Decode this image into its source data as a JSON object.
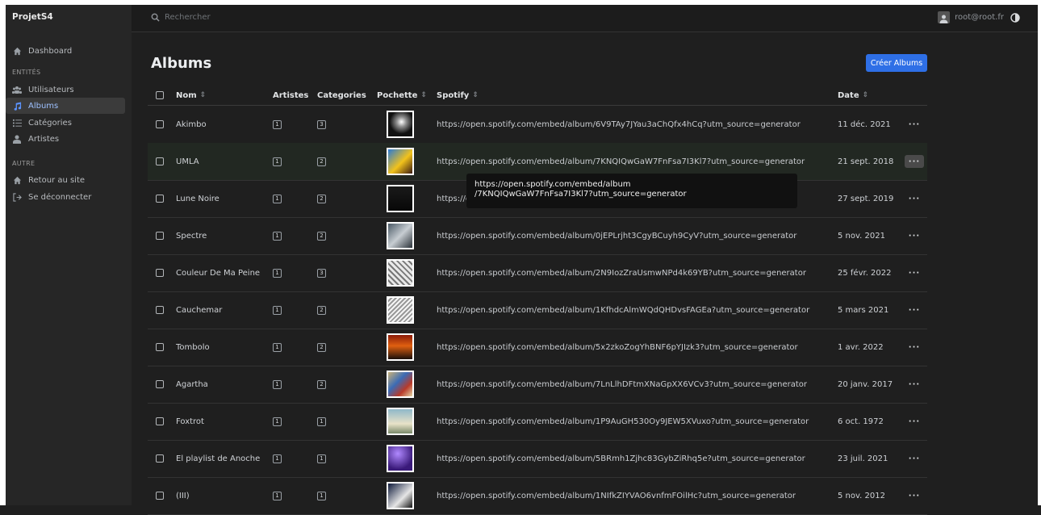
{
  "app": {
    "name": "ProjetS4"
  },
  "sidebar": {
    "items": [
      {
        "label": "Dashboard",
        "icon": "home-icon"
      },
      {
        "label": "Utilisateurs",
        "icon": "users-icon"
      },
      {
        "label": "Albums",
        "icon": "music-icon"
      },
      {
        "label": "Catégories",
        "icon": "list-icon"
      },
      {
        "label": "Artistes",
        "icon": "user-icon"
      },
      {
        "label": "Retour au site",
        "icon": "home-icon"
      },
      {
        "label": "Se déconnecter",
        "icon": "sign-out-icon"
      }
    ],
    "sections": {
      "entities": "ENTITÉS",
      "other": "AUTRE"
    },
    "active": "Albums"
  },
  "header": {
    "search_placeholder": "Rechercher",
    "user": "root@root.fr"
  },
  "page": {
    "title": "Albums",
    "create_label": "Créer Albums"
  },
  "table": {
    "columns": {
      "name": "Nom",
      "artists": "Artistes",
      "categories": "Categories",
      "cover": "Pochette",
      "spotify": "Spotify",
      "date": "Date",
      "sort_glyph": "⇕"
    },
    "rows": [
      {
        "name": "Akimbo",
        "artists": "1",
        "categories": "3",
        "spotify": "https://open.spotify.com/embed/album/6V9TAy7JYau3aChQfx4hCq?utm_source=generator",
        "date": "11 déc. 2021"
      },
      {
        "name": "UMLA",
        "artists": "1",
        "categories": "2",
        "spotify": "https://open.spotify.com/embed/album/7KNQIQwGaW7FnFsa7I3Kl7?utm_source=generator",
        "date": "21 sept. 2018"
      },
      {
        "name": "Lune Noire",
        "artists": "1",
        "categories": "2",
        "spotify": "https://open.spotify.com/embed/album/...?utm_source=generator",
        "date": "27 sept. 2019"
      },
      {
        "name": "Spectre",
        "artists": "1",
        "categories": "2",
        "spotify": "https://open.spotify.com/embed/album/0jEPLrjht3CgyBCuyh9CyV?utm_source=generator",
        "date": "5 nov. 2021"
      },
      {
        "name": "Couleur De Ma Peine",
        "artists": "1",
        "categories": "3",
        "spotify": "https://open.spotify.com/embed/album/2N9IozZraUsmwNPd4k69YB?utm_source=generator",
        "date": "25 févr. 2022"
      },
      {
        "name": "Cauchemar",
        "artists": "1",
        "categories": "2",
        "spotify": "https://open.spotify.com/embed/album/1KfhdcAlmWQdQHDvsFAGEa?utm_source=generator",
        "date": "5 mars 2021"
      },
      {
        "name": "Tombolo",
        "artists": "1",
        "categories": "2",
        "spotify": "https://open.spotify.com/embed/album/5x2zkoZogYhBNF6pYJIzk3?utm_source=generator",
        "date": "1 avr. 2022"
      },
      {
        "name": "Agartha",
        "artists": "1",
        "categories": "2",
        "spotify": "https://open.spotify.com/embed/album/7LnLlhDFtmXNaGpXX6VCv3?utm_source=generator",
        "date": "20 janv. 2017"
      },
      {
        "name": "Foxtrot",
        "artists": "1",
        "categories": "1",
        "spotify": "https://open.spotify.com/embed/album/1P9AuGH530Oy9JEW5XVuxo?utm_source=generator",
        "date": "6 oct. 1972"
      },
      {
        "name": "El playlist de Anoche",
        "artists": "1",
        "categories": "1",
        "spotify": "https://open.spotify.com/embed/album/5BRmh1Zjhc83GybZiRhq5e?utm_source=generator",
        "date": "23 juil. 2021"
      },
      {
        "name": "(III)",
        "artists": "1",
        "categories": "1",
        "spotify": "https://open.spotify.com/embed/album/1NIfkZIYVAO6vnfmFOilHc?utm_source=generator",
        "date": "5 nov. 2012"
      }
    ],
    "actions_label": "···"
  },
  "tooltip": {
    "line1": "https://open.spotify.com/embed/album",
    "line2": "/7KNQIQwGaW7FnFsa7I3Kl7?utm_source=generator"
  },
  "colors": {
    "accent": "#2e6fe6",
    "background": "#1f1f1f",
    "sidebar": "#262626"
  }
}
